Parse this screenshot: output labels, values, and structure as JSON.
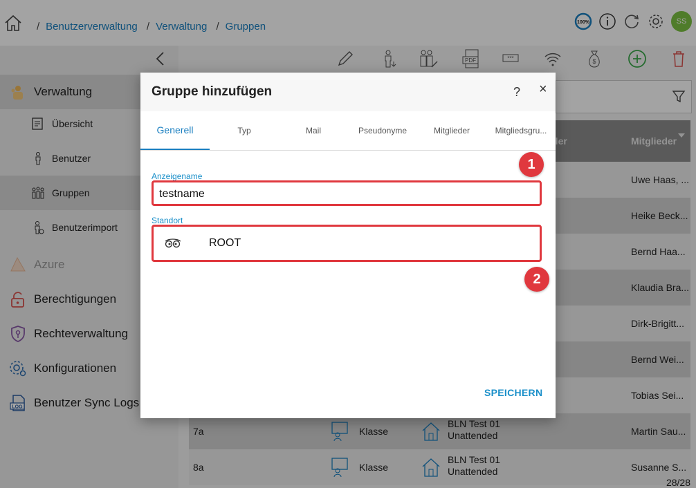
{
  "breadcrumb": [
    "Benutzerverwaltung",
    "Verwaltung",
    "Gruppen"
  ],
  "header_icons": [
    "zoom-100-icon",
    "info-icon",
    "refresh-icon",
    "settings-icon"
  ],
  "zoom_label": "100%",
  "avatar_initials": "SS",
  "sidebar": {
    "items": [
      {
        "label": "Verwaltung",
        "icon": "admin-icon"
      },
      {
        "label": "Übersicht",
        "icon": "overview-icon"
      },
      {
        "label": "Benutzer",
        "icon": "user-icon"
      },
      {
        "label": "Gruppen",
        "icon": "groups-icon"
      },
      {
        "label": "Benutzerimport",
        "icon": "user-import-icon"
      },
      {
        "label": "Azure",
        "icon": "azure-icon"
      },
      {
        "label": "Berechtigungen",
        "icon": "lock-icon"
      },
      {
        "label": "Rechteverwaltung",
        "icon": "shield-key-icon"
      },
      {
        "label": "Konfigurationen",
        "icon": "config-icon"
      },
      {
        "label": "Benutzer Sync Logs",
        "icon": "log-icon"
      }
    ]
  },
  "toolbar_icons": [
    "edit-icon",
    "user-download-icon",
    "users-edit-icon",
    "pdf-icon",
    "password-icon",
    "wifi-icon",
    "money-bag-icon",
    "add-icon",
    "delete-icon"
  ],
  "table": {
    "headers": [
      "eller",
      "Mitglieder"
    ],
    "rows": [
      {
        "members": "Uwe Haas, ..."
      },
      {
        "members": "Heike Beck..."
      },
      {
        "members": "Bernd Haa..."
      },
      {
        "members": "Klaudia Bra..."
      },
      {
        "members": "Dirk-Brigitt..."
      },
      {
        "members": "Bernd Wei..."
      },
      {
        "members": "Tobias Sei..."
      },
      {
        "name": "7a",
        "type": "Klasse",
        "location_line1": "BLN Test 01",
        "location_line2": "Unattended",
        "members": "Martin Sau..."
      },
      {
        "name": "8a",
        "type": "Klasse",
        "location_line1": "BLN Test 01",
        "location_line2": "Unattended",
        "members": "Susanne S..."
      }
    ],
    "count": "28/28"
  },
  "dialog": {
    "title": "Gruppe hinzufügen",
    "help": "?",
    "close": "×",
    "tabs": [
      "Generell",
      "Typ",
      "Mail",
      "Pseudonyme",
      "Mitglieder",
      "Mitgliedsgru..."
    ],
    "fields": {
      "display_name_label": "Anzeigename",
      "display_name_value": "testname",
      "location_label": "Standort",
      "location_value": "ROOT"
    },
    "save_label": "SPEICHERN",
    "badges": [
      "1",
      "2"
    ]
  },
  "colors": {
    "accent": "#1a7fc0",
    "highlight": "#e0383e",
    "avatar": "#7cc242"
  }
}
